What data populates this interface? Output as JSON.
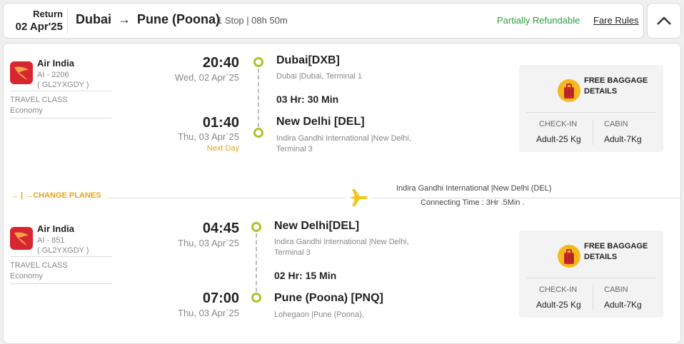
{
  "header": {
    "return_label": "Return",
    "return_date": "02 Apr'25",
    "origin": "Dubai",
    "arrow": "→",
    "destination": "Pune (Poona)",
    "stops_duration": "1 Stop | 08h 50m",
    "refund_status": "Partially Refundable",
    "fare_rules_label": "Fare Rules",
    "collapse_icon": "chevron-up-icon"
  },
  "segments": [
    {
      "airline": "Air India",
      "flight_no": "AI - 2206",
      "pnr": "( GL2YXGDY )",
      "travel_class_label": "TRAVEL CLASS",
      "travel_class": "Economy",
      "dep_time": "20:40",
      "dep_date": "Wed, 02 Apr`25",
      "dep_airport": "Dubai[DXB]",
      "dep_sub": "Dubai |Dubai, Terminal 1",
      "duration": "03 Hr: 30 Min",
      "arr_time": "01:40",
      "arr_date": "Thu, 03 Apr`25",
      "arr_note": "Next Day",
      "arr_airport": "New Delhi [DEL]",
      "arr_sub": "Indira Gandhi International |New Delhi, Terminal 3",
      "baggage": {
        "title": "FREE BAGGAGE DETAILS",
        "checkin_label": "CHECK-IN",
        "checkin_value": "Adult-25 Kg",
        "cabin_label": "CABIN",
        "cabin_value": "Adult-7Kg"
      }
    },
    {
      "airline": "Air India",
      "flight_no": "AI - 851",
      "pnr": "( GL2YXGDY )",
      "travel_class_label": "TRAVEL CLASS",
      "travel_class": "Economy",
      "dep_time": "04:45",
      "dep_date": "Thu, 03 Apr`25",
      "dep_airport": "New Delhi[DEL]",
      "dep_sub": "Indira Gandhi International |New Delhi, Terminal 3",
      "duration": "02 Hr: 15 Min",
      "arr_time": "07:00",
      "arr_date": "Thu, 03 Apr`25",
      "arr_airport": "Pune (Poona) [PNQ]",
      "arr_sub": "Lohegaon |Pune (Poona),",
      "baggage": {
        "title": "FREE BAGGAGE DETAILS",
        "checkin_label": "CHECK-IN",
        "checkin_value": "Adult-25 Kg",
        "cabin_label": "CABIN",
        "cabin_value": "Adult-7Kg"
      }
    }
  ],
  "layover": {
    "change_label": "→ | →CHANGE PLANES",
    "airport": "Indira Gandhi International |New Delhi (DEL)",
    "connecting_time": "Connecting Time : 3Hr .5Min ."
  },
  "colors": {
    "accent_green": "#a8c62a",
    "refund_green": "#2e9e40",
    "orange": "#e8a31b",
    "airline_red": "#d7262f"
  }
}
